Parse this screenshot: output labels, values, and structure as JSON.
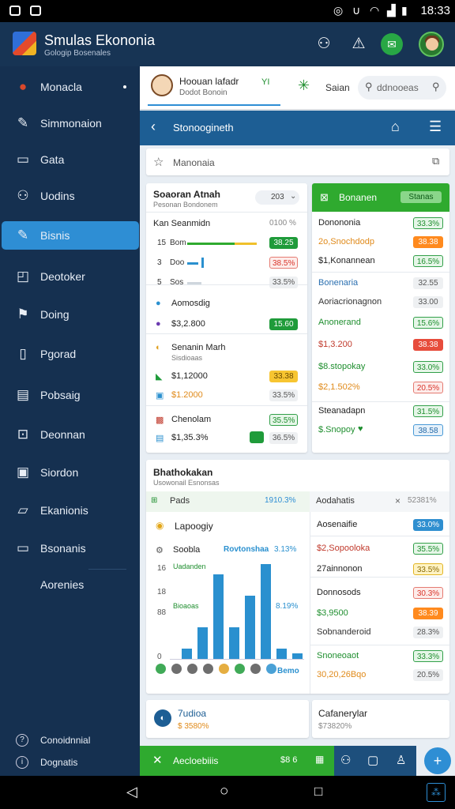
{
  "status": {
    "time": "18:33"
  },
  "app": {
    "title": "Smulas Ekononia",
    "subtitle": "Gologip Bosenales"
  },
  "sidebar": {
    "items": [
      {
        "label": "Monacla",
        "icon": "ball-icon"
      },
      {
        "label": "Simmonaion",
        "icon": "pen-icon"
      },
      {
        "label": "Gata",
        "icon": "document-icon"
      },
      {
        "label": "Uodins",
        "icon": "people-icon"
      },
      {
        "label": "Bisnis",
        "icon": "pen-icon"
      },
      {
        "label": "Deotoker",
        "icon": "box-icon"
      },
      {
        "label": "Doing",
        "icon": "flag-icon"
      },
      {
        "label": "Pgorad",
        "icon": "doc-icon"
      },
      {
        "label": "Pobsaig",
        "icon": "report-icon"
      },
      {
        "label": "Deonnan",
        "icon": "search-doc-icon"
      },
      {
        "label": "Siordon",
        "icon": "clipboard-icon"
      },
      {
        "label": "Ekanionis",
        "icon": "folder-icon"
      },
      {
        "label": "Bsonanis",
        "icon": "folder-alert-icon"
      },
      {
        "label": "Aorenies",
        "icon": "blank"
      }
    ],
    "footer": [
      {
        "label": "Conoidnnial",
        "icon": "help-icon"
      },
      {
        "label": "Dognatis",
        "icon": "info-icon"
      }
    ]
  },
  "profile_card": {
    "name": "Hoouan lafadr",
    "sub": "Dodot Bonoin",
    "badge": "YI"
  },
  "search": {
    "button": "Saian",
    "placeholder": "ddnooeas"
  },
  "bluebar": {
    "title": "Stonoogineth"
  },
  "filter": {
    "text": "Manonaia"
  },
  "panel_left": {
    "title": "Soaoran Atnah",
    "subtitle": "Pesonan Bondonem",
    "select": "203",
    "section_title": "Kan Seanmidn",
    "section_value": "0100 %",
    "rows": [
      {
        "num": "15",
        "label": "Bom",
        "pill": "38.25",
        "pill_style": "gs"
      },
      {
        "num": "3",
        "label": "Doo",
        "pill": "38.5%",
        "pill_style": "pk"
      },
      {
        "num": "5",
        "label": "Sos",
        "pill": "33.5%",
        "pill_style": "gr"
      }
    ],
    "items": [
      {
        "label": "Aomosdig",
        "value": ""
      },
      {
        "label": "$3,2.800",
        "value": "15.60"
      },
      {
        "label": "Senanin Marh",
        "value": ""
      },
      {
        "label": "Sisdioaas",
        "value": ""
      },
      {
        "label": "$1,12000",
        "value": "33.38"
      },
      {
        "label": "$1.2000",
        "value": "33.5%"
      },
      {
        "label": "Chenolam",
        "value": "35.5%"
      },
      {
        "label": "$1,35.3%",
        "value": "36.5%"
      }
    ]
  },
  "panel_right": {
    "title": "Bonanen",
    "header_pill": "Stanas",
    "rows": [
      {
        "label": "Donononia",
        "value": "33.3%",
        "style": "g"
      },
      {
        "label": "2o,Snochdodp",
        "value": "38.38",
        "style": "o"
      },
      {
        "label": "$1,Konannean",
        "value": "16.5%",
        "style": "g"
      },
      {
        "label": "Bonenaria",
        "value": "32.55",
        "style": "gr"
      },
      {
        "label": "Aoriacrionagnon",
        "value": "33.00",
        "style": "gr"
      },
      {
        "label": "Anonerand",
        "value": "15.6%",
        "style": "g"
      },
      {
        "label": "$1,3.200",
        "value": "38.38",
        "style": "r"
      },
      {
        "label": "$8.stopokay",
        "value": "33.0%",
        "style": "g"
      },
      {
        "label": "$2,1.502%",
        "value": "20.5%",
        "style": "pk"
      },
      {
        "label": "Steanadapn",
        "value": "31.5%",
        "style": "g"
      },
      {
        "label": "$.Snopoy",
        "value": "38.58",
        "style": "lb"
      }
    ]
  },
  "analytics": {
    "title": "Bhathokakan",
    "subtitle": "Usowonail Esnonsas",
    "tab_left": "Pads",
    "tab_left_value": "1910.3%",
    "tab_right": "Aodahatis",
    "tab_right_value": "52381%",
    "left_label": "Lapoogiy",
    "legend": {
      "a": "Soobla",
      "b": "Rovtonshaa",
      "b_value": "3.13%"
    },
    "legend2": "Uadanden",
    "axis_labels": [
      "16",
      "18",
      "88",
      "0"
    ],
    "ann": {
      "left": "Bioaoas",
      "right": "8.19%"
    },
    "chart_link": "Bemo",
    "bar_values": [
      1,
      3,
      8,
      3,
      6,
      9,
      1,
      0.5
    ],
    "right_rows": [
      {
        "label": "Aosenaifie",
        "value": "33.0%",
        "style": "b"
      },
      {
        "label": "$2,Sopooloka",
        "value": "35.5%",
        "style": "g"
      },
      {
        "label": "27ainnonon",
        "value": "33.5%",
        "style": "ry"
      },
      {
        "label": "Donnosods",
        "value": "30.3%",
        "style": "pk"
      },
      {
        "label": "$3,9500",
        "value": "38.39",
        "style": "o"
      },
      {
        "label": "Sobnanderoid",
        "value": "28.3%",
        "style": "gr"
      },
      {
        "label": "Snoneoaot",
        "value": "33.3%",
        "style": "g"
      },
      {
        "label": "30,20,26Bqo",
        "value": "20.5%",
        "style": "gr"
      }
    ]
  },
  "bottom_cards": [
    {
      "title": "7udioa",
      "value": "$ 3580%"
    },
    {
      "title": "Cafanerylar",
      "value": "$73820%"
    }
  ],
  "action_bar": {
    "label": "Aecloebiiis",
    "value": "$8 6"
  }
}
